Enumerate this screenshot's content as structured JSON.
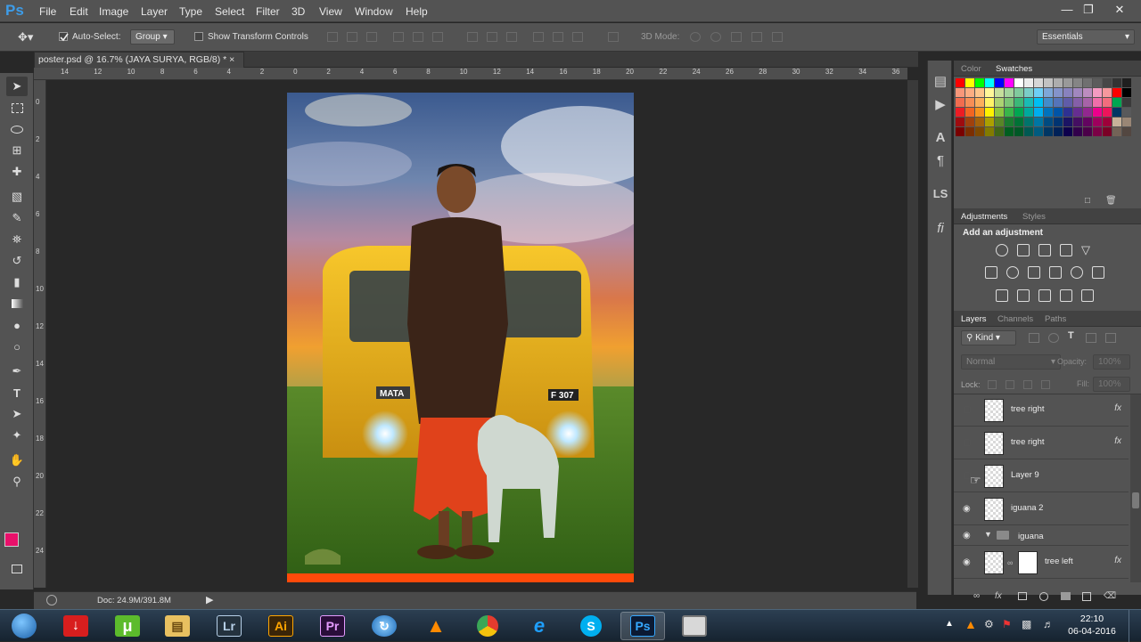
{
  "app": {
    "logo": "Ps"
  },
  "menu": [
    "File",
    "Edit",
    "Image",
    "Layer",
    "Type",
    "Select",
    "Filter",
    "3D",
    "View",
    "Window",
    "Help"
  ],
  "options": {
    "auto_select": "Auto-Select:",
    "group": "Group",
    "transform": "Show Transform Controls",
    "mode3d": "3D Mode:",
    "workspace": "Essentials"
  },
  "document": {
    "tab": "poster.psd @ 16.7% (JAYA SURYA, RGB/8) *",
    "status": "Doc: 24.9M/391.8M"
  },
  "ruler": {
    "top": [
      "14",
      "12",
      "10",
      "8",
      "6",
      "4",
      "2",
      "0",
      "2",
      "4",
      "6",
      "8",
      "10",
      "12",
      "14",
      "16",
      "18",
      "20",
      "22",
      "24",
      "26",
      "28",
      "30",
      "32",
      "34",
      "36"
    ],
    "left": [
      "0",
      "2",
      "4",
      "6",
      "8",
      "10",
      "12",
      "14",
      "16",
      "18",
      "20",
      "22",
      "24"
    ]
  },
  "poster": {
    "bus_text": "MATA",
    "plate": "F 307"
  },
  "panels": {
    "color_tabs": [
      "Color",
      "Swatches"
    ],
    "adj_tabs": [
      "Adjustments",
      "Styles"
    ],
    "adj_title": "Add an adjustment",
    "layer_tabs": [
      "Layers",
      "Channels",
      "Paths"
    ],
    "kind": "Kind",
    "blend": "Normal",
    "opacity_label": "Opacity:",
    "opacity_value": "100%",
    "lock_label": "Lock:",
    "fill_label": "Fill:",
    "fill_value": "100%",
    "layers": [
      {
        "name": "tree right",
        "visible": false,
        "fx": "fx"
      },
      {
        "name": "tree right",
        "visible": false,
        "fx": "fx"
      },
      {
        "name": "Layer 9",
        "visible": false,
        "fx": ""
      },
      {
        "name": "iguana 2",
        "visible": true,
        "fx": ""
      },
      {
        "name": "iguana",
        "visible": true,
        "fx": "",
        "group": true
      },
      {
        "name": "tree left",
        "visible": true,
        "fx": "fx"
      }
    ],
    "swatch_colors": [
      "#ff0000",
      "#ffff00",
      "#00ff00",
      "#00ffff",
      "#0000ff",
      "#ff00ff",
      "#ffffff",
      "#ebebeb",
      "#d6d6d6",
      "#c2c2c2",
      "#adadad",
      "#999999",
      "#858585",
      "#707070",
      "#5c5c5c",
      "#474747",
      "#333333",
      "#1f1f1f",
      "#f7977a",
      "#fbad82",
      "#fdc68c",
      "#fff799",
      "#c6df9c",
      "#a4d49d",
      "#81ca9d",
      "#7bcdc8",
      "#6ecff6",
      "#7ea7d8",
      "#8493ca",
      "#8882be",
      "#a187be",
      "#bc8dbf",
      "#f49bc1",
      "#f5989d",
      "#ff0000",
      "#000000",
      "#f26c4f",
      "#f68e56",
      "#fbaf5c",
      "#fff467",
      "#acd372",
      "#7cc576",
      "#3bb878",
      "#1abbb4",
      "#00bff3",
      "#438cca",
      "#5574b9",
      "#605ca8",
      "#855fa8",
      "#a763a8",
      "#f06ea9",
      "#f26d7d",
      "#00a651",
      "#3a3a3a",
      "#ed1c24",
      "#f26522",
      "#f7941d",
      "#fff200",
      "#8dc63f",
      "#39b54a",
      "#00a651",
      "#00a99d",
      "#00aeef",
      "#0072bc",
      "#0054a6",
      "#2e3192",
      "#662d91",
      "#92278f",
      "#ec008c",
      "#ed145b",
      "#003663",
      "#58595b",
      "#9e0b0f",
      "#a0410d",
      "#a3620a",
      "#aba000",
      "#598527",
      "#1a7b30",
      "#007236",
      "#00746b",
      "#0076a3",
      "#004b80",
      "#003471",
      "#1b1464",
      "#440e62",
      "#630460",
      "#9e005d",
      "#9e0039",
      "#c7b299",
      "#998675",
      "#790000",
      "#7b2e00",
      "#7d4900",
      "#827b00",
      "#406618",
      "#005e20",
      "#005826",
      "#005952",
      "#005b7f",
      "#003663",
      "#002157",
      "#0d004c",
      "#32004b",
      "#4b0049",
      "#7b0046",
      "#7a0026",
      "#736357",
      "#534741"
    ]
  },
  "taskbar": {
    "apps": [
      "Lr",
      "Ai",
      "Pr",
      "Ps"
    ],
    "time": "22:10",
    "date": "06-04-2016"
  }
}
